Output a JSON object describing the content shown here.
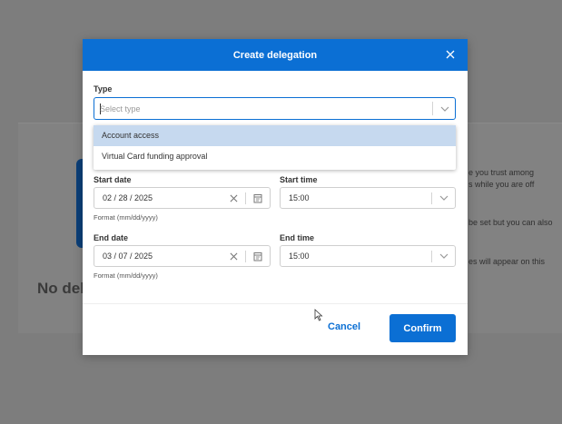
{
  "background": {
    "title": "No del",
    "side_text": [
      "e you trust among",
      "s while you are off",
      "be set but you can also",
      "es will appear on this"
    ]
  },
  "modal": {
    "title": "Create delegation",
    "type_label": "Type",
    "type_placeholder": "Select type",
    "type_options": [
      "Account access",
      "Virtual Card funding approval"
    ],
    "start_date_label": "Start date",
    "start_date_value": "02 / 28 / 2025",
    "start_time_label": "Start time",
    "start_time_value": "15:00",
    "date_format_hint": "Format (mm/dd/yyyy)",
    "end_date_label": "End date",
    "end_date_value": "03 / 07 / 2025",
    "end_time_label": "End time",
    "end_time_value": "15:00",
    "end_format_hint": "Format (mm/dd/yyyy)",
    "cancel_label": "Cancel",
    "confirm_label": "Confirm"
  },
  "colors": {
    "accent": "#0b6fd4",
    "overlay": "#7d7d7d",
    "highlight": "#c6d9ef"
  },
  "icons": [
    "close-icon",
    "chevron-down-icon",
    "clear-icon",
    "calendar-icon",
    "mouse-cursor-icon"
  ]
}
